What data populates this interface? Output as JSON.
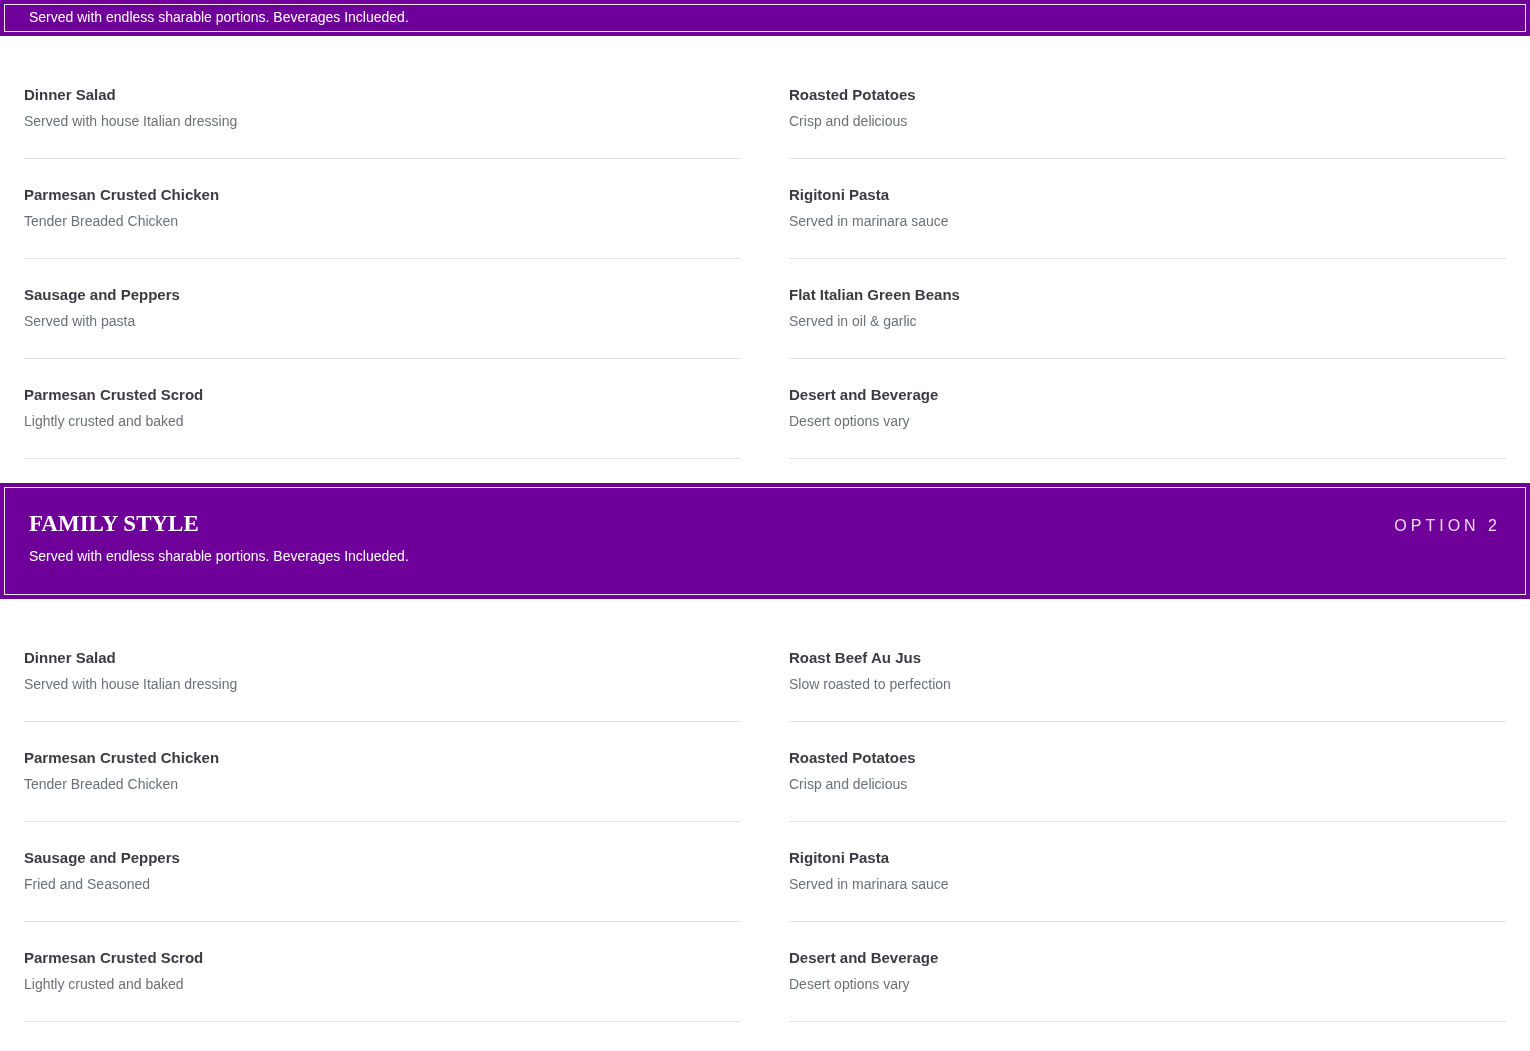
{
  "sections": [
    {
      "banner": {
        "subtitle": "Served with endless sharable portions. Beverages Inclueded."
      },
      "columns": [
        [
          {
            "name": "Dinner Salad",
            "description": "Served with house Italian dressing"
          },
          {
            "name": "Parmesan Crusted Chicken",
            "description": "Tender Breaded Chicken"
          },
          {
            "name": "Sausage and Peppers",
            "description": "Served with pasta"
          },
          {
            "name": "Parmesan Crusted Scrod",
            "description": "Lightly crusted and baked"
          }
        ],
        [
          {
            "name": "Roasted Potatoes",
            "description": "Crisp and delicious"
          },
          {
            "name": "Rigitoni Pasta",
            "description": "Served in marinara sauce"
          },
          {
            "name": "Flat Italian Green Beans",
            "description": "Served in oil & garlic"
          },
          {
            "name": "Desert and Beverage",
            "description": "Desert options vary"
          }
        ]
      ]
    },
    {
      "banner": {
        "title": "FAMILY STYLE",
        "subtitle": "Served with endless sharable portions. Beverages Inclueded.",
        "option": "OPTION 2"
      },
      "columns": [
        [
          {
            "name": "Dinner Salad",
            "description": "Served with house Italian dressing"
          },
          {
            "name": "Parmesan Crusted Chicken",
            "description": "Tender Breaded Chicken"
          },
          {
            "name": "Sausage and Peppers",
            "description": "Fried and Seasoned"
          },
          {
            "name": "Parmesan Crusted Scrod",
            "description": "Lightly crusted and baked"
          }
        ],
        [
          {
            "name": "Roast Beef Au Jus",
            "description": "Slow roasted to perfection"
          },
          {
            "name": "Roasted Potatoes",
            "description": "Crisp and delicious"
          },
          {
            "name": "Rigitoni Pasta",
            "description": "Served in marinara sauce"
          },
          {
            "name": "Desert and Beverage",
            "description": "Desert options vary"
          }
        ]
      ]
    }
  ]
}
